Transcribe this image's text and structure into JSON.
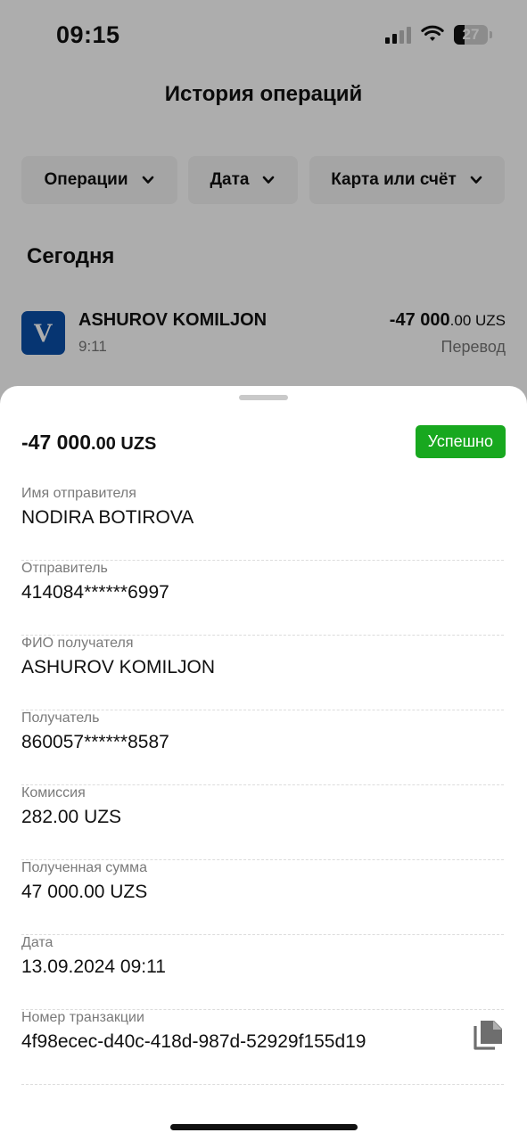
{
  "status_bar": {
    "time": "09:15",
    "battery": "27"
  },
  "history": {
    "title": "История операций",
    "filters": [
      {
        "label": "Операции",
        "icon": "chevron-down-icon"
      },
      {
        "label": "Дата",
        "icon": "chevron-down-icon"
      },
      {
        "label": "Карта или счёт",
        "icon": "chevron-down-icon"
      }
    ],
    "section": "Сегодня",
    "operation": {
      "logo_letter": "V",
      "name": "ASHUROV KOMILJON",
      "time": "9:11",
      "amount_main": "-47 000",
      "amount_dec": ".00 UZS",
      "type": "Перевод"
    }
  },
  "sheet": {
    "amount_main": "-47 000",
    "amount_dec": ".00 UZS",
    "status": "Успешно",
    "status_color": "#18a81f",
    "fields": [
      {
        "label": "Имя отправителя",
        "value": "NODIRA BOTIROVA"
      },
      {
        "label": "Отправитель",
        "value": "414084******6997"
      },
      {
        "label": "ФИО получателя",
        "value": "ASHUROV KOMILJON"
      },
      {
        "label": "Получатель",
        "value": "860057******8587"
      },
      {
        "label": "Комиссия",
        "value": "282.00 UZS"
      },
      {
        "label": "Полученная сумма",
        "value": "47 000.00 UZS"
      },
      {
        "label": "Дата",
        "value": "13.09.2024 09:11"
      },
      {
        "label": "Номер транзакции",
        "value": "4f98ecec-d40c-418d-987d-52929f155d19",
        "icon": "copy-icon"
      }
    ]
  }
}
